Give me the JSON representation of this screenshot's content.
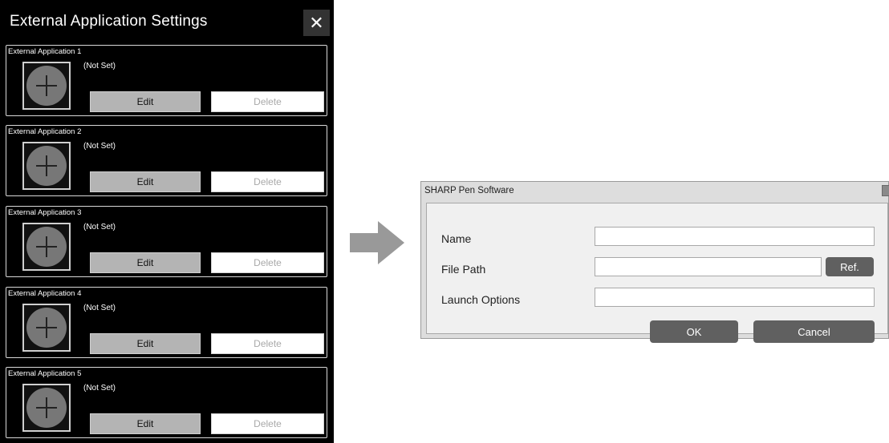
{
  "settings_panel": {
    "title": "External Application Settings",
    "close_label": "✕",
    "apps": [
      {
        "label": "External Application 1",
        "status": "(Not Set)",
        "edit_label": "Edit",
        "delete_label": "Delete"
      },
      {
        "label": "External Application 2",
        "status": "(Not Set)",
        "edit_label": "Edit",
        "delete_label": "Delete"
      },
      {
        "label": "External Application 3",
        "status": "(Not Set)",
        "edit_label": "Edit",
        "delete_label": "Delete"
      },
      {
        "label": "External Application 4",
        "status": "(Not Set)",
        "edit_label": "Edit",
        "delete_label": "Delete"
      },
      {
        "label": "External Application 5",
        "status": "(Not Set)",
        "edit_label": "Edit",
        "delete_label": "Delete"
      }
    ]
  },
  "arrow": {
    "icon": "right-arrow-icon"
  },
  "dialog": {
    "title": "SHARP Pen Software",
    "name_label": "Name",
    "name_value": "",
    "file_path_label": "File Path",
    "file_path_value": "",
    "ref_label": "Ref.",
    "launch_options_label": "Launch Options",
    "launch_options_value": "",
    "ok_label": "OK",
    "cancel_label": "Cancel"
  },
  "colors": {
    "panel_background": "#000000",
    "edit_button": "#b4b4b4",
    "dialog_button": "#606060",
    "arrow": "#999999"
  }
}
